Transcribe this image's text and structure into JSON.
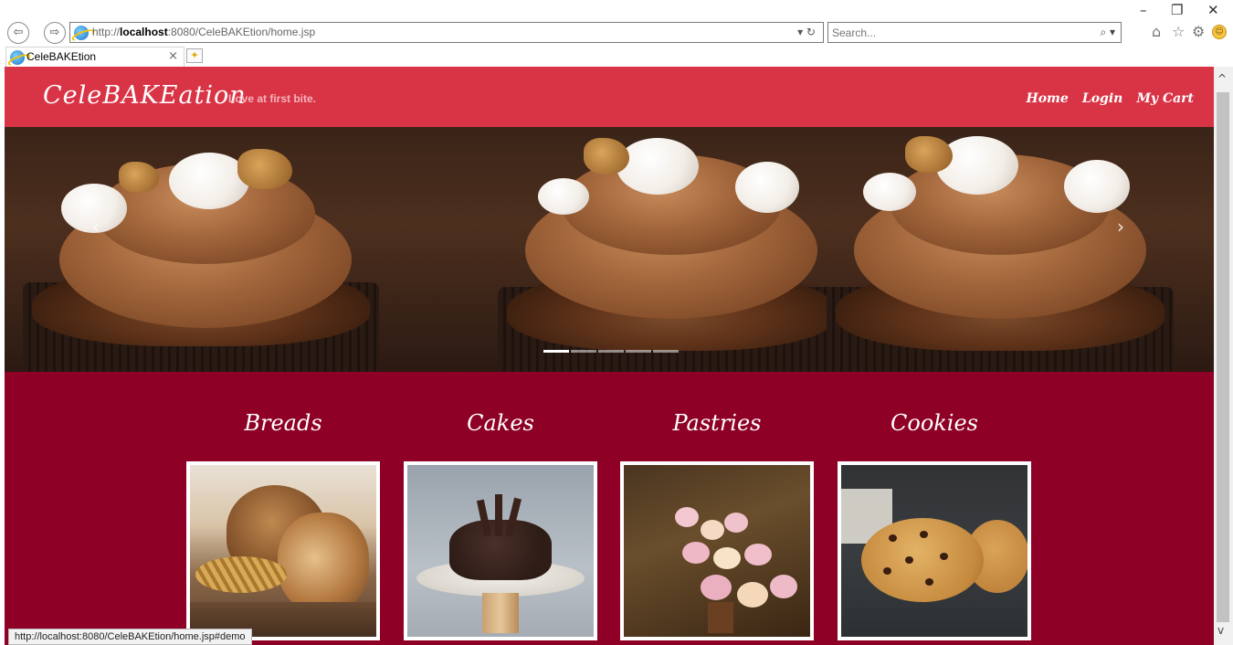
{
  "browser": {
    "address": {
      "prefix": "http://",
      "host": "localhost",
      "rest": ":8080/CeleBAKEtion/home.jsp"
    },
    "search_placeholder": "Search...",
    "tab_title": "CeleBAKEtion",
    "status_url": "http://localhost:8080/CeleBAKEtion/home.jsp#demo"
  },
  "site": {
    "brand": "CeleBAKEation",
    "tagline": "Love at first bite.",
    "nav": [
      "Home",
      "Login",
      "My Cart"
    ],
    "header_color": "#d93446",
    "body_color": "#8e0026"
  },
  "carousel": {
    "slide_count": 5,
    "active_index": 0
  },
  "categories": [
    {
      "title": "Breads"
    },
    {
      "title": "Cakes"
    },
    {
      "title": "Pastries"
    },
    {
      "title": "Cookies"
    }
  ]
}
